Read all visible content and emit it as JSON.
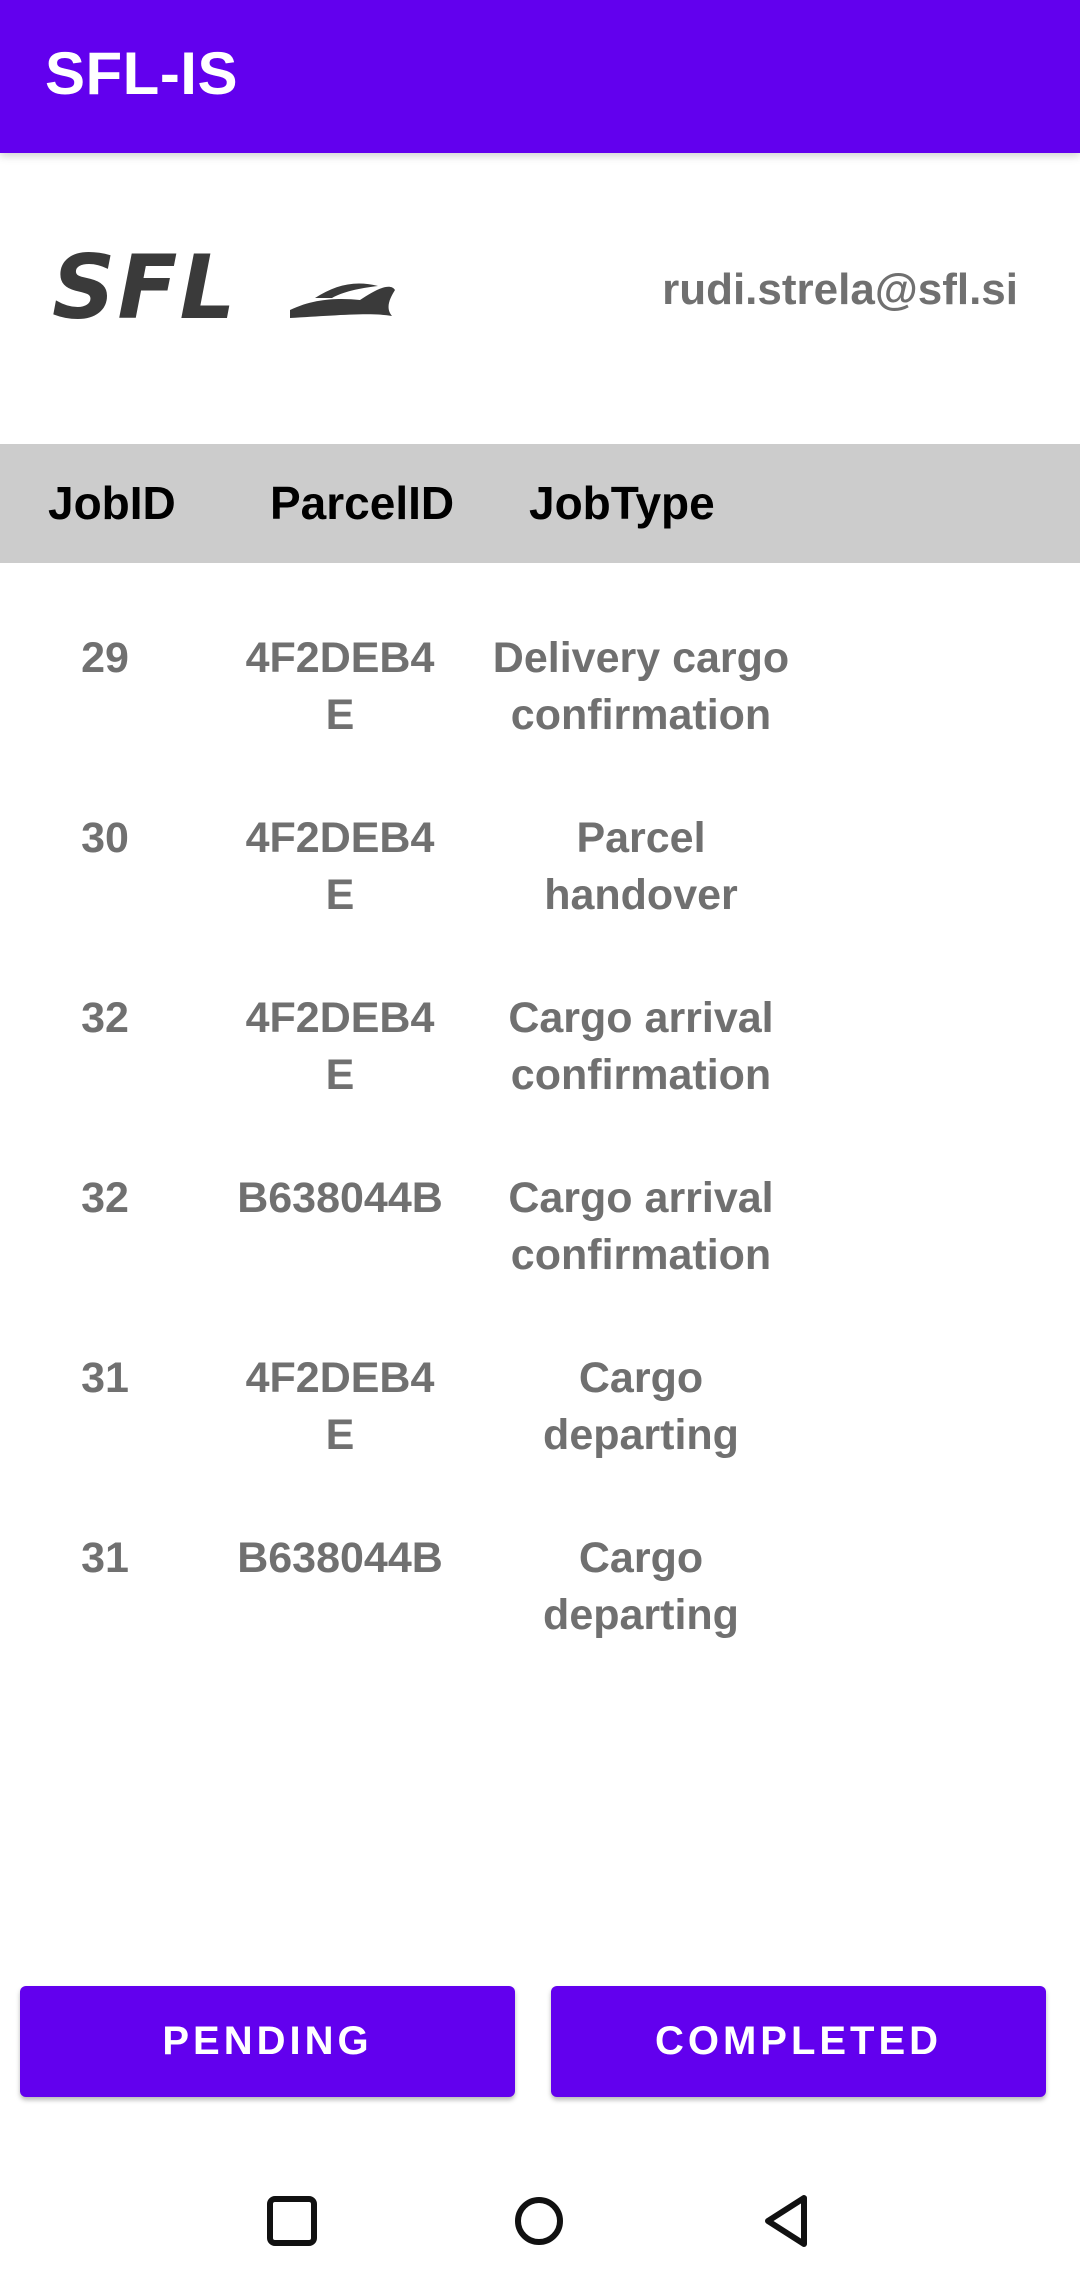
{
  "app": {
    "title": "SFL-IS",
    "accent_color": "#6200EE"
  },
  "header": {
    "logo_icon": "sfl-logo",
    "logo_text": "SFL",
    "user_email": "rudi.strela@sfl.si"
  },
  "table": {
    "columns": [
      "JobID",
      "ParcelID",
      "JobType"
    ],
    "rows": [
      {
        "job_id": "29",
        "parcel_id": "4F2DEB4E",
        "job_type": "Delivery cargo confirmation"
      },
      {
        "job_id": "30",
        "parcel_id": "4F2DEB4E",
        "job_type": "Parcel handover"
      },
      {
        "job_id": "32",
        "parcel_id": "4F2DEB4E",
        "job_type": "Cargo arrival confirmation"
      },
      {
        "job_id": "32",
        "parcel_id": "B638044B",
        "job_type": "Cargo arrival confirmation"
      },
      {
        "job_id": "31",
        "parcel_id": "4F2DEB4E",
        "job_type": "Cargo departing"
      },
      {
        "job_id": "31",
        "parcel_id": "B638044B",
        "job_type": "Cargo departing"
      }
    ]
  },
  "buttons": {
    "pending_label": "PENDING",
    "completed_label": "COMPLETED"
  },
  "navigation": {
    "items": [
      "recents-icon",
      "home-icon",
      "back-icon"
    ]
  }
}
